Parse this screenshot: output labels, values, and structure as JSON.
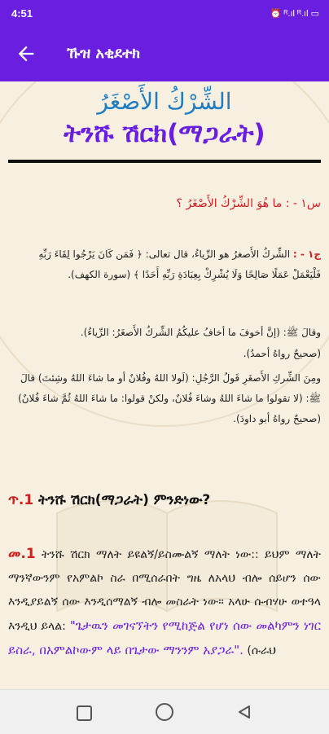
{
  "status": {
    "time": "4:51",
    "icons_text": "⏰ ᴿ.ıl ᴿ.ıl ▭"
  },
  "header": {
    "title": "ኹዝ አቂደተክ"
  },
  "heading": {
    "arabic": "الشِّرْكُ الأَصْغَرُ",
    "amharic": "ትንሹ ሽርክ(ማጋራት)"
  },
  "q1": {
    "text": "س١ - : ما هُوَ الشِّرْكُ الأَصْغَرُ ؟"
  },
  "a1": {
    "label": "ج١ - :",
    "line1": "الشِّركُ الأَصغرُ هو الرِّياءُ، قال تعالى: ﴿ فَمَن كَانَ يَرْجُوا لِقَاءَ رَبِّهِ فَلْيَعْمَلْ عَمَلًا صَالِحًا وَلَا يُشْرِكْ بِعِبَادَةِ رَبِّهِ أَحَدًا ﴾ (سورة الكهف).",
    "line2": "وقالَ ﷺ: (إنَّ أخوفَ ما أخافُ عليكُمُ الشِّركُ الأَصغَرُ: الرِّياءُ).",
    "line3": "(صحيحٌ رواهُ أحمدُ).",
    "line4": "ومِنَ الشِّركِ الأَصغَرِ قَولُ الرَّجُلِ: (لَولا اللهُ وفُلانٌ أو ما شاءَ اللهُ وشِئتَ) قالَ ﷺ: (لا تقولوا ما شاءَ اللهُ وشاءَ فُلانٌ، ولكنْ قولوا: ما شاءَ اللهُ ثُمَّ شاءَ فُلانٌ) (صحيحٌ رواهُ أبو داودَ)."
  },
  "q2": {
    "num": "ጥ.1",
    "text": "ትንሹ ሽርክ(ማጋራት) ምንድነው?"
  },
  "a2": {
    "num": "መ.1",
    "text": "ትንሹ ሽርክ ማለት ይዩልኝ/ይስሙልኝ ማለት ነው:: ይህም ማለት ማንኛውንም የአምልኮ ስራ በሚሰራበት ግዜ ለአላህ ብሎ ሰይሆን ሰው እንዲያይልኝ ሰው እንዲሰማልኝ ብሎ መስራት ነው። አላሁ ሱብሃሁ ወተዓላ እንዲህ ይላል:",
    "quote": "\"ጌታዉን መገናኘትን የሚከጅል የሆነ ሰው መልካምን ነገር ይስራ, በአምልኮውም ላይ በጌታው ማንንም አያጋራ\".",
    "source": "(ሱራህ"
  }
}
